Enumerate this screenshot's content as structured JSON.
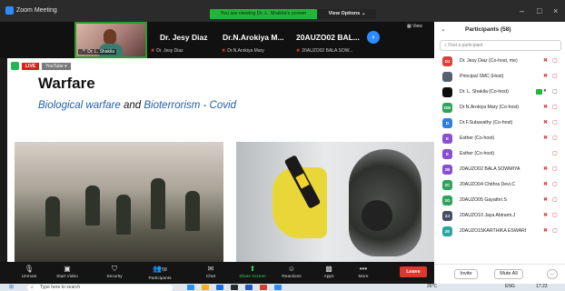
{
  "window": {
    "title": "Zoom Meeting",
    "viewing_banner": "You are viewing Dr. L. Shakila's screen",
    "view_options": "View Options ⌄",
    "controls": [
      "–",
      "□",
      "×"
    ]
  },
  "video_strip": {
    "active_tile_name": "Dr. L. Shakila",
    "tiles": [
      {
        "big_name": "Dr. Jesy Diaz",
        "small_name": "Dr. Jesy Diaz"
      },
      {
        "big_name": "Dr.N.Arokiya  M...",
        "small_name": "Dr.N.Arokiya Mary"
      },
      {
        "big_name": "20AUZO02  BAL...",
        "small_name": "20AUZO02 BALA SOW..."
      }
    ],
    "next_icon": "›",
    "view_label": "▦ View"
  },
  "share": {
    "live_label": "LIVE",
    "youtube_label": "YouTube ▾",
    "slide_title": "Warfare",
    "subtitle_part1": "Biological warfare",
    "subtitle_part2": "and",
    "subtitle_part3": "Bioterrorism  - Covid"
  },
  "toolbar": {
    "items": [
      {
        "icon": "microphone-icon",
        "glyph": "🎙",
        "label": "Unmute"
      },
      {
        "icon": "video-icon",
        "glyph": "▣",
        "label": "Start Video"
      },
      {
        "icon": "shield-icon",
        "glyph": "⛉",
        "label": "Security"
      },
      {
        "icon": "participants-icon",
        "glyph": "👥",
        "label": "Participants",
        "count": "58"
      },
      {
        "icon": "chat-icon",
        "glyph": "✉",
        "label": "Chat"
      },
      {
        "icon": "share-screen-icon",
        "glyph": "⬆",
        "label": "Share Screen"
      },
      {
        "icon": "reactions-icon",
        "glyph": "☺",
        "label": "Reactions"
      },
      {
        "icon": "apps-icon",
        "glyph": "▩",
        "label": "Apps"
      },
      {
        "icon": "more-icon",
        "glyph": "•••",
        "label": "More"
      }
    ],
    "leave_label": "Leave"
  },
  "participants_panel": {
    "title": "Participants (58)",
    "search_placeholder": "Find a participant",
    "participants": [
      {
        "initials": "DJ",
        "color": "#d9413a",
        "name": "Dr. Jesy Diaz (Co-host, me)"
      },
      {
        "initials": "",
        "color": "#556070",
        "name": "Principal SMC (Host)"
      },
      {
        "initials": "",
        "color": "#0e0e0e",
        "name": "Dr. L. Shakila (Co-host)"
      },
      {
        "initials": "DM",
        "color": "#2ea35a",
        "name": "Dr.N.Arokiya Mary (Co-host)"
      },
      {
        "initials": "D",
        "color": "#2d7fe0",
        "name": "Dr.F.Subavathy (Co-host)"
      },
      {
        "initials": "E",
        "color": "#8a4fd0",
        "name": "Esther (Co-host)"
      },
      {
        "initials": "E",
        "color": "#8a4fd0",
        "name": "Esther (Co-host)"
      },
      {
        "initials": "2B",
        "color": "#8a4fd0",
        "name": "20AUZO02 BALA SOWMIYA"
      },
      {
        "initials": "2C",
        "color": "#2ea35a",
        "name": "20AUZO04 Chithra Devi.C"
      },
      {
        "initials": "2G",
        "color": "#2ea35a",
        "name": "20AUZO05 Gayathri.S"
      },
      {
        "initials": "2J",
        "color": "#445066",
        "name": "20AUZO10 Jaya Abirami.J"
      },
      {
        "initials": "2E",
        "color": "#2aa6a0",
        "name": "20AUZO15KARTHIKA ESWARI"
      }
    ],
    "invite_label": "Invite",
    "mute_all_label": "Mute All",
    "more_label": "…"
  },
  "taskbar": {
    "search_placeholder": "Type here to search",
    "temperature": "26°C",
    "language": "ENG",
    "time": "17:23"
  }
}
